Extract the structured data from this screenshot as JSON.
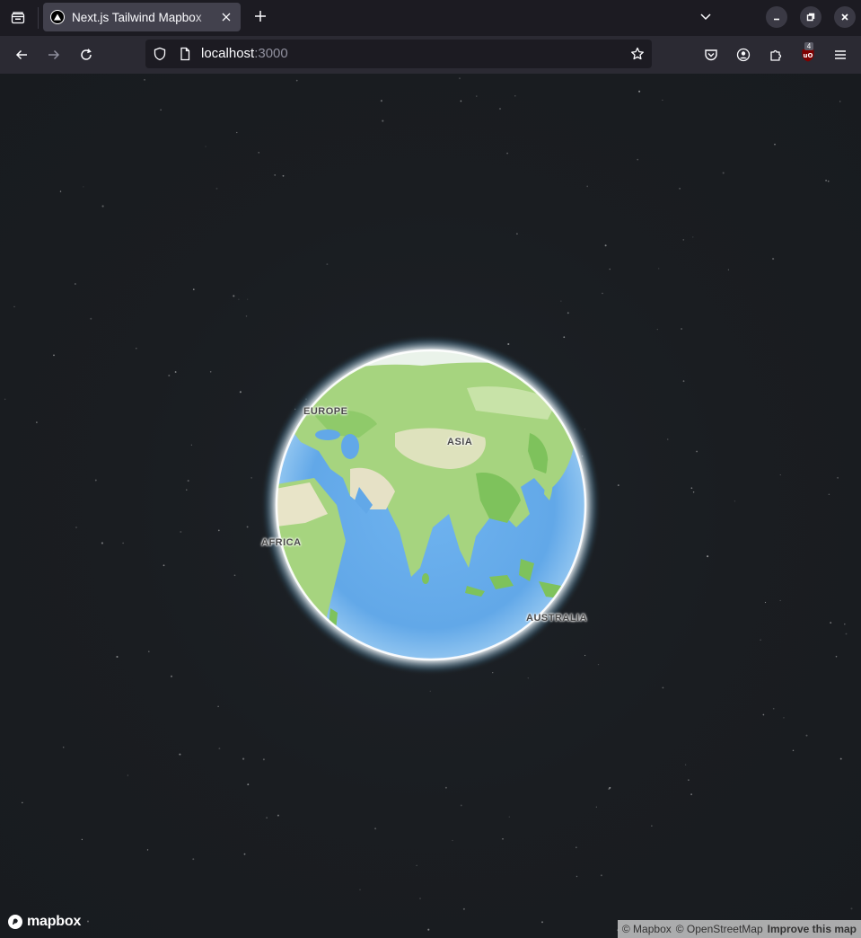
{
  "browser": {
    "tab": {
      "title": "Next.js Tailwind Mapbox"
    },
    "url": {
      "host": "localhost",
      "port": ":3000"
    },
    "extension_badge": "4",
    "icons": {
      "tab_overview": "tab-overview-icon",
      "favicon": "nextjs-triangle-icon",
      "close_tab": "close-icon",
      "new_tab": "plus-icon",
      "list_all_tabs": "chevron-down-icon",
      "minimize": "minimize-icon",
      "maximize": "maximize-icon",
      "close_window": "close-icon",
      "back": "arrow-left-icon",
      "forward": "arrow-right-icon",
      "reload": "reload-icon",
      "shield": "shield-icon",
      "page": "page-icon",
      "bookmark": "star-icon",
      "pocket": "pocket-icon",
      "account": "account-icon",
      "extensions": "puzzle-icon",
      "ublock": "ublock-origin-icon",
      "menu": "hamburger-menu-icon"
    }
  },
  "map": {
    "labels": {
      "europe": "EUROPE",
      "asia": "ASIA",
      "africa": "AFRICA",
      "australia": "AUSTRALIA"
    },
    "logo_text": "mapbox",
    "attribution": {
      "mapbox": "© Mapbox",
      "osm": "© OpenStreetMap",
      "improve": "Improve this map"
    },
    "colors": {
      "space": "#1a1d21",
      "ocean": "#62a8e8",
      "land": "#a6d47f",
      "atmosphere": "#ffffff"
    }
  }
}
